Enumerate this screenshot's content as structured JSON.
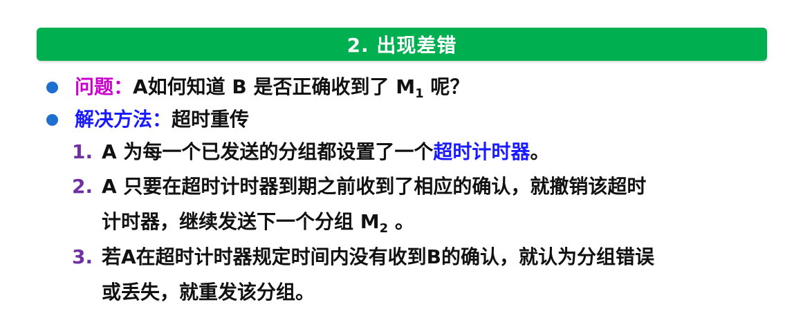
{
  "header": {
    "title": "2. 出现差错"
  },
  "question": {
    "label": "问题：",
    "text_before_sub": "A如何知道 B 是否正确收到了 M",
    "sub": "1",
    "text_after_sub": " 呢？"
  },
  "solution": {
    "label": "解决方法：",
    "text": "超时重传"
  },
  "steps": [
    {
      "number": "1.",
      "text": "A 为每一个已发送的分组都设置了一个",
      "highlight": "超时计时器",
      "tail": "。"
    },
    {
      "number": "2.",
      "line1": "A 只要在超时计时器到期之前收到了相应的确认，就撤销该超时",
      "line2_before_sub": "计时器，继续发送下一个分组 M",
      "line2_sub": "2",
      "line2_after_sub": " 。"
    },
    {
      "number": "3.",
      "line1": "若A在超时计时器规定时间内没有收到B的确认，就认为分组错误",
      "line2": "或丢失，就重发该分组。"
    }
  ],
  "colors": {
    "banner": "#00b050",
    "bullet": "#1f6fd1",
    "question_label": "#cc00cc",
    "solution_label": "#1a1aff",
    "highlight": "#1a1aff",
    "step_number": "#7030a0"
  }
}
